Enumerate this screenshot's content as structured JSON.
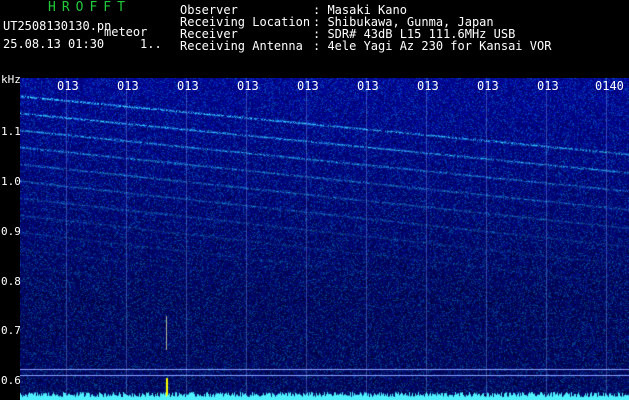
{
  "header": {
    "app_title": "HROFFT",
    "file_name": "UT2508130130.pn",
    "file_suffix": "meteor",
    "date_time": "25.08.13 01:30",
    "extra_value": "1.."
  },
  "info": [
    {
      "label": "Observer",
      "value": ": Masaki Kano"
    },
    {
      "label": "Receiving Location",
      "value": ": Shibukawa, Gunma, Japan"
    },
    {
      "label": "Receiver",
      "value": ": SDR# 43dB L15 111.6MHz USB"
    },
    {
      "label": "Receiving Antenna",
      "value": ": 4ele Yagi Az 230 for Kansai VOR"
    }
  ],
  "freq_axis": {
    "unit": "kHz",
    "ticks": [
      "1.1",
      "1.0",
      "0.9",
      "0.8",
      "0.7",
      "0.6"
    ]
  },
  "time_axis": {
    "ticks": [
      "013",
      "013",
      "013",
      "013",
      "013",
      "013",
      "013",
      "013",
      "013",
      "0140"
    ]
  },
  "colors": {
    "background": "#000000",
    "spectrum_base": "#00003a",
    "signal": "#4ff0ff",
    "marker": "#ffff00",
    "title": "#22c93a"
  }
}
